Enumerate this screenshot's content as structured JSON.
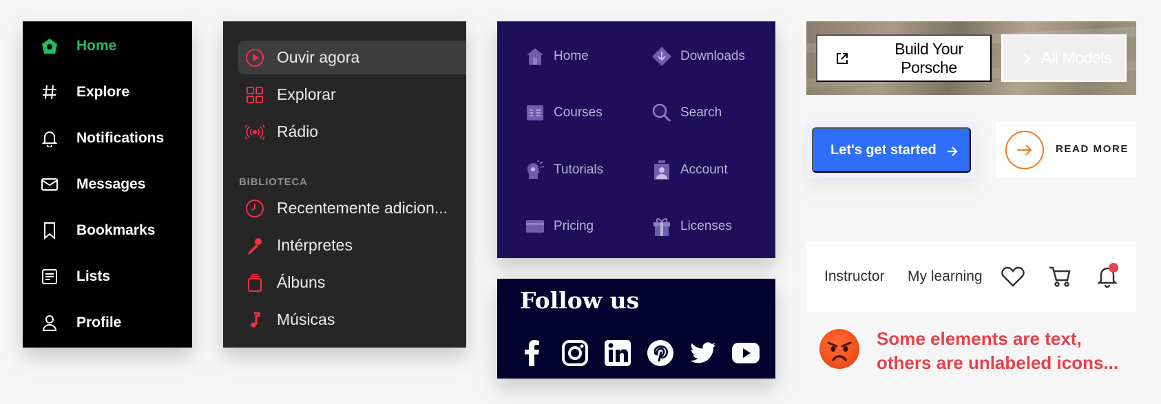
{
  "twitter_nav": {
    "accent": "#1fbd5a",
    "items": [
      {
        "label": "Home",
        "icon": "birdhouse-icon"
      },
      {
        "label": "Explore",
        "icon": "hashtag-icon"
      },
      {
        "label": "Notifications",
        "icon": "bell-icon"
      },
      {
        "label": "Messages",
        "icon": "envelope-icon"
      },
      {
        "label": "Bookmarks",
        "icon": "bookmark-icon"
      },
      {
        "label": "Lists",
        "icon": "list-document-icon"
      },
      {
        "label": "Profile",
        "icon": "person-icon"
      }
    ]
  },
  "music_nav": {
    "accent": "#fa2d48",
    "top_items": [
      {
        "label": "Ouvir agora",
        "icon": "play-circle-icon",
        "selected": true
      },
      {
        "label": "Explorar",
        "icon": "grid-icon"
      },
      {
        "label": "Rádio",
        "icon": "radio-waves-icon"
      }
    ],
    "section_label": "BIBLIOTECA",
    "library_items": [
      {
        "label": "Recentemente adicion...",
        "icon": "clock-icon"
      },
      {
        "label": "Intérpretes",
        "icon": "microphone-icon"
      },
      {
        "label": "Álbuns",
        "icon": "album-stack-icon"
      },
      {
        "label": "Músicas",
        "icon": "music-note-icon"
      }
    ]
  },
  "grid_nav": {
    "items": [
      {
        "label": "Home",
        "icon": "house-icon"
      },
      {
        "label": "Downloads",
        "icon": "download-diamond-icon"
      },
      {
        "label": "Courses",
        "icon": "courses-icon"
      },
      {
        "label": "Search",
        "icon": "magnifier-icon"
      },
      {
        "label": "Tutorials",
        "icon": "idea-head-icon"
      },
      {
        "label": "Account",
        "icon": "account-badge-icon"
      },
      {
        "label": "Pricing",
        "icon": "credit-card-icon"
      },
      {
        "label": "Licenses",
        "icon": "gift-icon"
      }
    ]
  },
  "follow": {
    "title": "Follow us",
    "networks": [
      "facebook-icon",
      "instagram-icon",
      "linkedin-icon",
      "pinterest-icon",
      "twitter-icon",
      "youtube-icon"
    ]
  },
  "porsche": {
    "build_label": "Build Your Porsche",
    "models_label": "All Models"
  },
  "cta": {
    "started_label": "Let's get started",
    "started_color": "#2f6ef7",
    "read_more_label": "READ MORE",
    "read_more_color": "#f07b20"
  },
  "udemy": {
    "links": [
      "Instructor",
      "My learning"
    ],
    "icons": [
      "heart-icon",
      "cart-icon",
      "bell-icon"
    ],
    "notification_dot_color": "#e8424f"
  },
  "note": {
    "emoji": "angry-face-emoji",
    "line1": "Some elements are text,",
    "line2": "others are unlabeled icons..."
  }
}
